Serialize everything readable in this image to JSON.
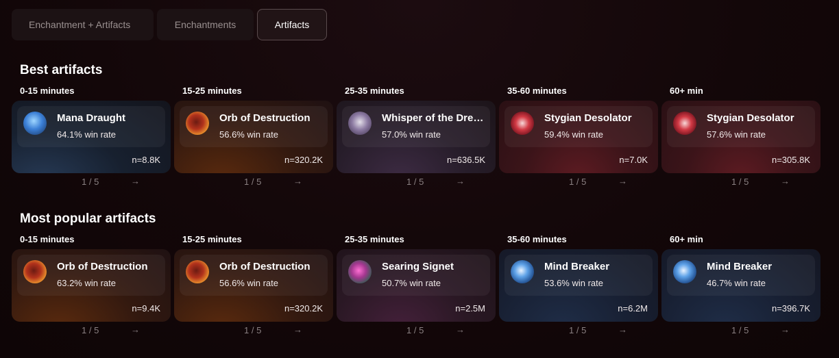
{
  "tabs": [
    {
      "label": "Enchantment + Artifacts",
      "active": false
    },
    {
      "label": "Enchantments",
      "active": false
    },
    {
      "label": "Artifacts",
      "active": true
    }
  ],
  "sections": [
    {
      "title": "Best artifacts",
      "columns": [
        {
          "label": "0-15 minutes",
          "item": "Mana Draught",
          "win_rate": "64.1% win rate",
          "n": "n=8.8K",
          "page": "1 / 5",
          "icon": "potion-icon",
          "theme": "blue"
        },
        {
          "label": "15-25 minutes",
          "item": "Orb of Destruction",
          "win_rate": "56.6% win rate",
          "n": "n=320.2K",
          "page": "1 / 5",
          "icon": "orb-icon",
          "theme": "orange"
        },
        {
          "label": "25-35 minutes",
          "item": "Whisper of the Dre…",
          "win_rate": "57.0% win rate",
          "n": "n=636.5K",
          "page": "1 / 5",
          "icon": "whisper-icon",
          "theme": "purple"
        },
        {
          "label": "35-60 minutes",
          "item": "Stygian Desolator",
          "win_rate": "59.4% win rate",
          "n": "n=7.0K",
          "page": "1 / 5",
          "icon": "desolator-icon",
          "theme": "red"
        },
        {
          "label": "60+ min",
          "item": "Stygian Desolator",
          "win_rate": "57.6% win rate",
          "n": "n=305.8K",
          "page": "1 / 5",
          "icon": "desolator-icon",
          "theme": "red"
        }
      ]
    },
    {
      "title": "Most popular artifacts",
      "columns": [
        {
          "label": "0-15 minutes",
          "item": "Orb of Destruction",
          "win_rate": "63.2% win rate",
          "n": "n=9.4K",
          "page": "1 / 5",
          "icon": "orb-icon",
          "theme": "orange"
        },
        {
          "label": "15-25 minutes",
          "item": "Orb of Destruction",
          "win_rate": "56.6% win rate",
          "n": "n=320.2K",
          "page": "1 / 5",
          "icon": "orb-icon",
          "theme": "orange"
        },
        {
          "label": "25-35 minutes",
          "item": "Searing Signet",
          "win_rate": "50.7% win rate",
          "n": "n=2.5M",
          "page": "1 / 5",
          "icon": "signet-icon",
          "theme": "pink"
        },
        {
          "label": "35-60 minutes",
          "item": "Mind Breaker",
          "win_rate": "53.6% win rate",
          "n": "n=6.2M",
          "page": "1 / 5",
          "icon": "mind-breaker-icon",
          "theme": "navy"
        },
        {
          "label": "60+ min",
          "item": "Mind Breaker",
          "win_rate": "46.7% win rate",
          "n": "n=396.7K",
          "page": "1 / 5",
          "icon": "mind-breaker-icon",
          "theme": "navy"
        }
      ]
    }
  ],
  "pager_arrow": "→"
}
